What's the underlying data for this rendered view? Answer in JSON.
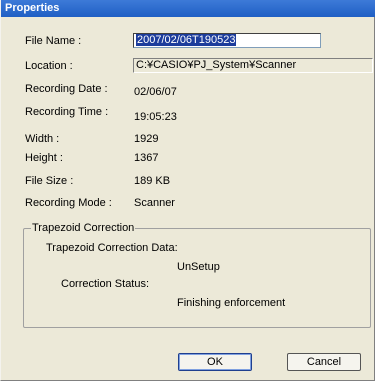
{
  "window": {
    "title": "Properties"
  },
  "fields": {
    "file_name_label": "File Name :",
    "file_name_value": "2007/02/06T190523",
    "location_label": "Location :",
    "location_value": "C:¥CASIO¥PJ_System¥Scanner",
    "recording_date_label": "Recording Date :",
    "recording_date_value": "02/06/07",
    "recording_time_label": "Recording Time :",
    "recording_time_value": "19:05:23",
    "width_label": "Width :",
    "width_value": "1929",
    "height_label": "Height :",
    "height_value": "1367",
    "file_size_label": "File Size :",
    "file_size_value": "189 KB",
    "recording_mode_label": "Recording Mode :",
    "recording_mode_value": "Scanner"
  },
  "trapezoid": {
    "group_title": "Trapezoid Correction",
    "data_label": "Trapezoid Correction Data:",
    "data_value": "UnSetup",
    "status_label": "Correction Status:",
    "status_value": "Finishing enforcement"
  },
  "buttons": {
    "ok": "OK",
    "cancel": "Cancel"
  }
}
